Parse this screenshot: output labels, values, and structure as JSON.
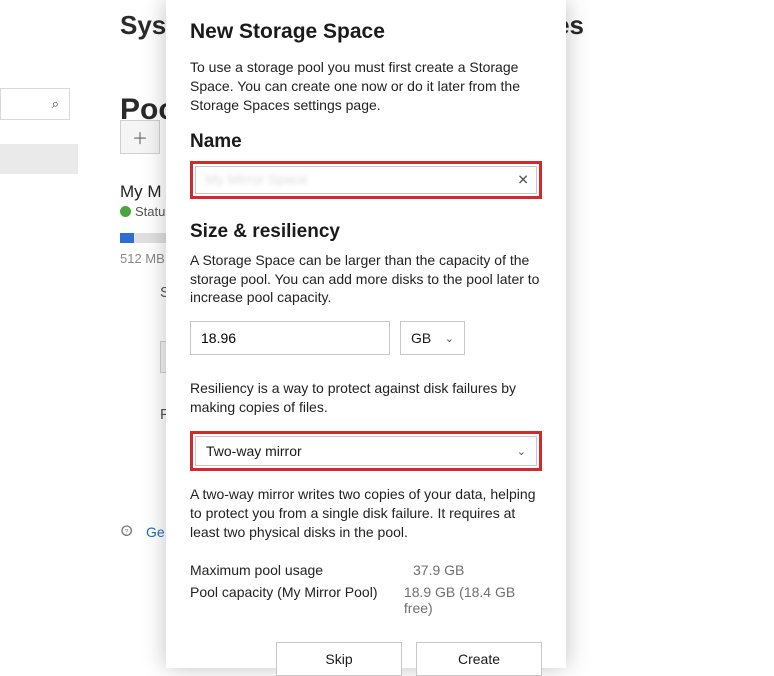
{
  "background": {
    "header": "Syst",
    "header_right": "es",
    "subheader": "Poo",
    "pool_name": "My M",
    "status_label": "Statu",
    "size_label": "512 MB",
    "letter_s": "S",
    "letter_p": "P",
    "help_text": "Ge"
  },
  "dialog": {
    "title": "New Storage Space",
    "intro": "To use a storage pool you must first create a Storage Space. You can create one now or do it later from the Storage Spaces settings page.",
    "name": {
      "label": "Name",
      "value": "My Mirror Space"
    },
    "size": {
      "label": "Size & resiliency",
      "desc": "A Storage Space can be larger than the capacity of the storage pool. You can add more disks to the pool later to increase pool capacity.",
      "value": "18.96",
      "unit": "GB"
    },
    "resiliency": {
      "desc": "Resiliency is a way to protect against disk failures by making copies of files.",
      "value": "Two-way mirror",
      "explain": "A two-way mirror writes two copies of your data, helping to protect you from a single disk failure. It requires at least two physical disks in the pool."
    },
    "info": {
      "max_label": "Maximum pool usage",
      "max_value": "37.9 GB",
      "cap_label": "Pool capacity (My Mirror Pool)",
      "cap_value": "18.9 GB (18.4 GB free)"
    },
    "buttons": {
      "skip": "Skip",
      "create": "Create"
    }
  }
}
